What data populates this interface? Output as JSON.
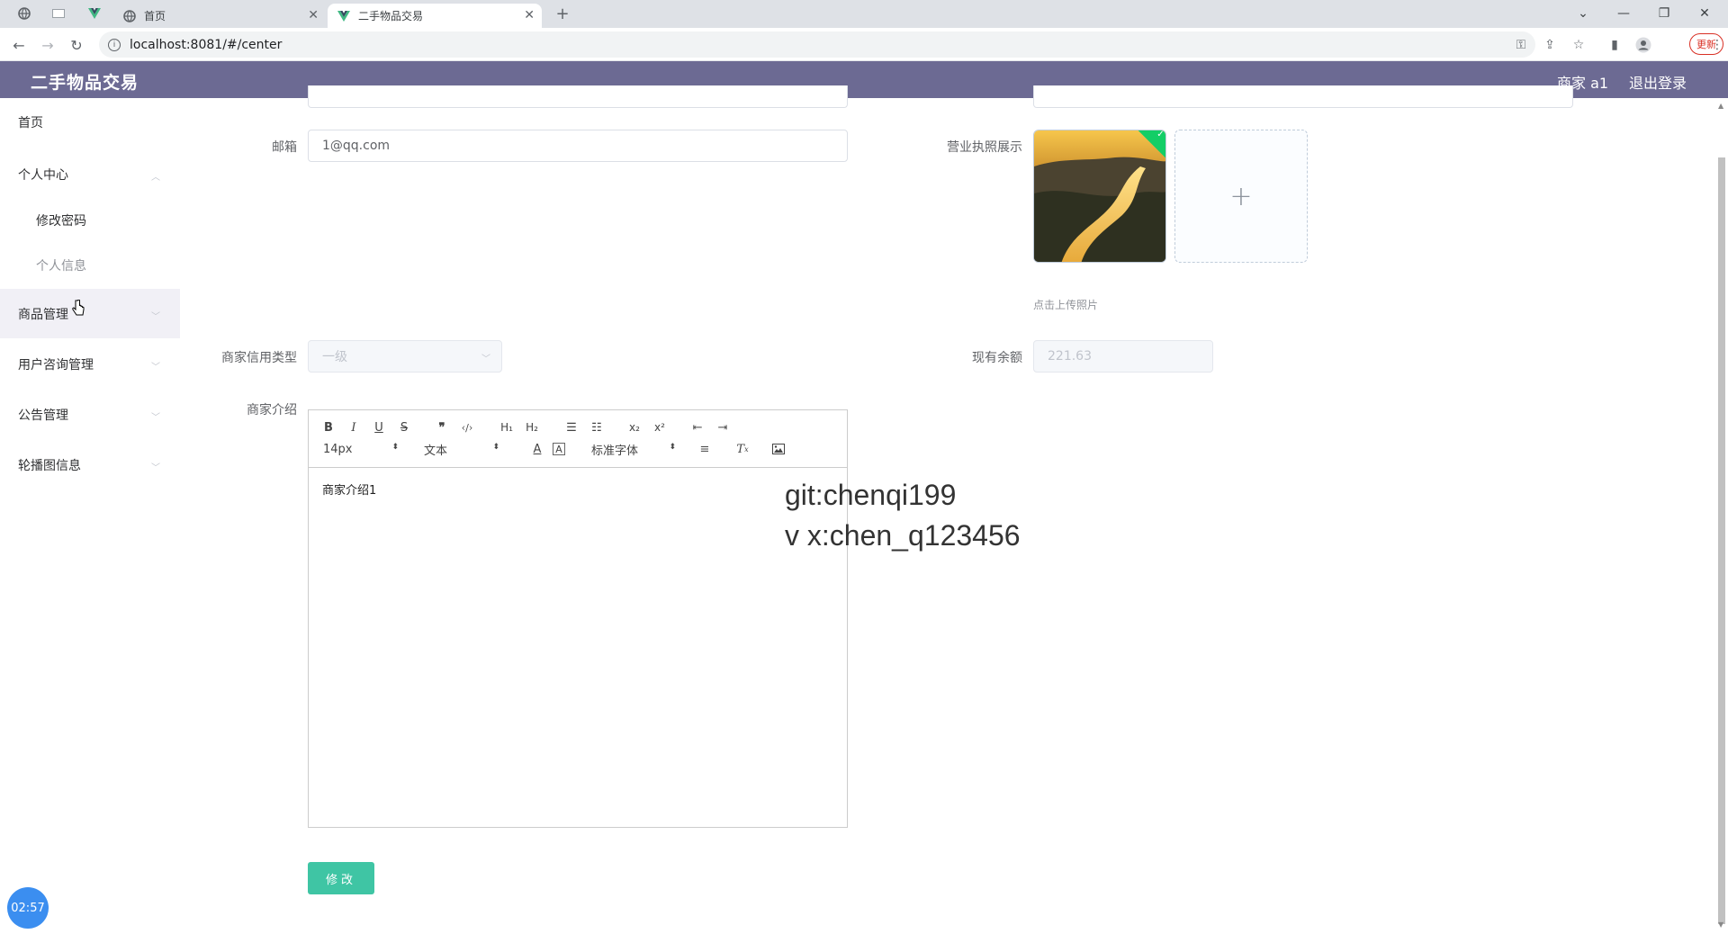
{
  "browser": {
    "tabs": [
      {
        "label": "首页"
      },
      {
        "label": "二手物品交易"
      }
    ],
    "url": "localhost:8081/#/center",
    "update_label": "更新"
  },
  "header": {
    "title": "二手物品交易",
    "user": "商家 a1",
    "logout": "退出登录"
  },
  "sidebar": {
    "items": [
      {
        "label": "首页"
      },
      {
        "label": "个人中心"
      },
      {
        "label": "修改密码"
      },
      {
        "label": "个人信息"
      },
      {
        "label": "商品管理"
      },
      {
        "label": "用户咨询管理"
      },
      {
        "label": "公告管理"
      },
      {
        "label": "轮播图信息"
      }
    ]
  },
  "form": {
    "email_label": "邮箱",
    "email_value": "1@qq.com",
    "license_label": "营业执照展示",
    "upload_hint": "点击上传照片",
    "credit_label": "商家信用类型",
    "credit_value": "一级",
    "balance_label": "现有余额",
    "balance_value": "221.63",
    "intro_label": "商家介绍",
    "editor": {
      "font_size": "14px",
      "block_type": "文本",
      "font_family": "标准字体",
      "content": "商家介绍1"
    },
    "submit_label": "修改"
  },
  "overlay": {
    "watermark_line1": "git:chenqi199",
    "watermark_line2": "v x:chen_q123456",
    "timer": "02:57"
  },
  "colors": {
    "header_bg": "#6c6a93",
    "submit_bg": "#3fc5a4",
    "upload_ok": "#13ce66",
    "timer_bg": "#3b8ef0"
  }
}
